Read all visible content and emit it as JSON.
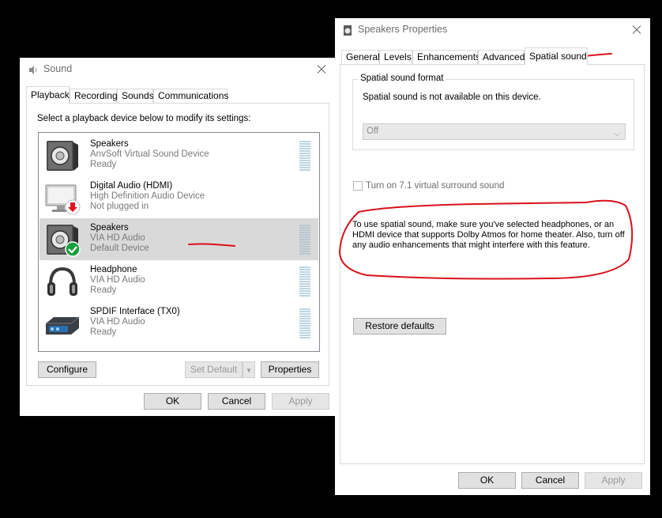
{
  "sound_dialog": {
    "title": "Sound",
    "tabs": [
      {
        "label": "Playback",
        "active": true
      },
      {
        "label": "Recording",
        "active": false
      },
      {
        "label": "Sounds",
        "active": false
      },
      {
        "label": "Communications",
        "active": false
      }
    ],
    "instruction": "Select a playback device below to modify its settings:",
    "devices": [
      {
        "name": "Speakers",
        "description": "AnvSoft Virtual Sound Device",
        "status": "Ready",
        "icon": "speaker-icon",
        "badge": "",
        "selected": false
      },
      {
        "name": "Digital Audio (HDMI)",
        "description": "High Definition Audio Device",
        "status": "Not plugged in",
        "icon": "monitor-icon",
        "badge": "unplugged-arrow-icon",
        "selected": false
      },
      {
        "name": "Speakers",
        "description": "VIA HD Audio",
        "status": "Default Device",
        "icon": "speaker-icon",
        "badge": "default-check-icon",
        "selected": true
      },
      {
        "name": "Headphone",
        "description": "VIA HD Audio",
        "status": "Ready",
        "icon": "headphones-icon",
        "badge": "",
        "selected": false
      },
      {
        "name": "SPDIF Interface (TX0)",
        "description": "VIA HD Audio",
        "status": "Ready",
        "icon": "spdif-device-icon",
        "badge": "",
        "selected": false
      }
    ],
    "buttons": {
      "configure": "Configure",
      "set_default": "Set Default",
      "properties": "Properties",
      "ok": "OK",
      "cancel": "Cancel",
      "apply": "Apply"
    }
  },
  "properties_dialog": {
    "title": "Speakers Properties",
    "tabs": [
      {
        "label": "General",
        "active": false
      },
      {
        "label": "Levels",
        "active": false
      },
      {
        "label": "Enhancements",
        "active": false
      },
      {
        "label": "Advanced",
        "active": false
      },
      {
        "label": "Spatial sound",
        "active": true
      }
    ],
    "format_group_label": "Spatial sound format",
    "not_available_text": "Spatial sound is not available on this device.",
    "format_select_value": "Off",
    "surround_checkbox_label": "Turn on 7.1 virtual surround sound",
    "surround_checked": false,
    "info_text": "To use spatial sound, make sure you've selected headphones, or an HDMI device that supports Dolby Atmos for home theater. Also, turn off any audio enhancements that might interfere with this feature.",
    "buttons": {
      "restore_defaults": "Restore defaults",
      "ok": "OK",
      "cancel": "Cancel",
      "apply": "Apply"
    }
  },
  "colors": {
    "annotation_red": "#d9111b",
    "selection_bg": "#d9d9d9",
    "default_check_green": "#14a03c",
    "unplugged_red": "#e81123"
  }
}
